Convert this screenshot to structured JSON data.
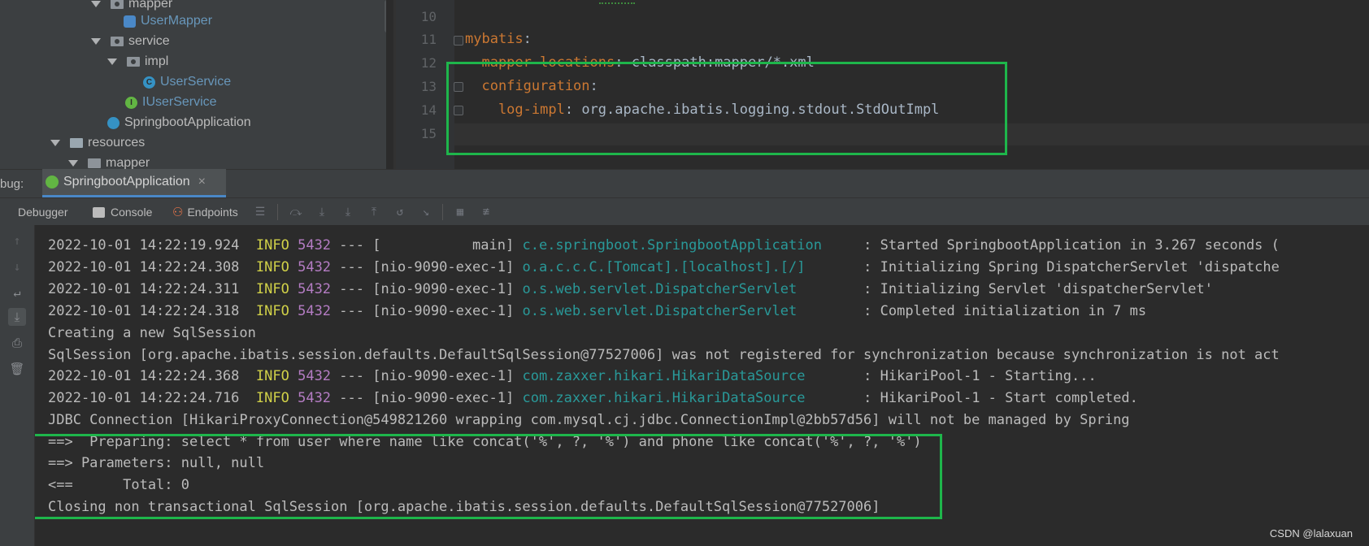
{
  "tree": {
    "items": [
      {
        "label": "mapper",
        "kind": "package"
      },
      {
        "label": "UserMapper",
        "kind": "mapper-interface"
      },
      {
        "label": "service",
        "kind": "package"
      },
      {
        "label": "impl",
        "kind": "package"
      },
      {
        "label": "UserService",
        "kind": "class"
      },
      {
        "label": "IUserService",
        "kind": "interface"
      },
      {
        "label": "SpringbootApplication",
        "kind": "spring-boot-class"
      },
      {
        "label": "resources",
        "kind": "folder"
      },
      {
        "label": "mapper",
        "kind": "folder"
      }
    ],
    "icons": {
      "class": "C",
      "interface": "I"
    }
  },
  "editor": {
    "lines": [
      {
        "num": "10",
        "key": "",
        "sep": "",
        "val": ""
      },
      {
        "num": "11",
        "key": "mybatis",
        "sep": ":",
        "val": ""
      },
      {
        "num": "12",
        "key": "  mapper-locations",
        "sep": ":",
        "val": " classpath:mapper/*.xml"
      },
      {
        "num": "13",
        "key": "  configuration",
        "sep": ":",
        "val": ""
      },
      {
        "num": "14",
        "key": "    log-impl",
        "sep": ":",
        "val": " org.apache.ibatis.logging.stdout.StdOutImpl"
      },
      {
        "num": "15",
        "key": "",
        "sep": "",
        "val": ""
      }
    ]
  },
  "debug": {
    "label": "bug:",
    "tab_label": "SpringbootApplication",
    "tab_close": "×",
    "toolbar": {
      "debugger": "Debugger",
      "console": "Console",
      "endpoints": "Endpoints"
    }
  },
  "console": {
    "lines": [
      {
        "ts": "2022-10-01 14:22:19.924",
        "level": "INFO",
        "pid": "5432",
        "sep": " --- ",
        "thread": "[           main]",
        "logger": "c.e.springboot.SpringbootApplication    ",
        "msg": ": Started SpringbootApplication in 3.267 seconds ("
      },
      {
        "ts": "2022-10-01 14:22:24.308",
        "level": "INFO",
        "pid": "5432",
        "sep": " --- ",
        "thread": "[nio-9090-exec-1]",
        "logger": "o.a.c.c.C.[Tomcat].[localhost].[/]      ",
        "msg": ": Initializing Spring DispatcherServlet 'dispatche"
      },
      {
        "ts": "2022-10-01 14:22:24.311",
        "level": "INFO",
        "pid": "5432",
        "sep": " --- ",
        "thread": "[nio-9090-exec-1]",
        "logger": "o.s.web.servlet.DispatcherServlet       ",
        "msg": ": Initializing Servlet 'dispatcherServlet'"
      },
      {
        "ts": "2022-10-01 14:22:24.318",
        "level": "INFO",
        "pid": "5432",
        "sep": " --- ",
        "thread": "[nio-9090-exec-1]",
        "logger": "o.s.web.servlet.DispatcherServlet       ",
        "msg": ": Completed initialization in 7 ms"
      },
      {
        "plain": "Creating a new SqlSession"
      },
      {
        "plain": "SqlSession [org.apache.ibatis.session.defaults.DefaultSqlSession@77527006] was not registered for synchronization because synchronization is not act"
      },
      {
        "ts": "2022-10-01 14:22:24.368",
        "level": "INFO",
        "pid": "5432",
        "sep": " --- ",
        "thread": "[nio-9090-exec-1]",
        "logger": "com.zaxxer.hikari.HikariDataSource      ",
        "msg": ": HikariPool-1 - Starting..."
      },
      {
        "ts": "2022-10-01 14:22:24.716",
        "level": "INFO",
        "pid": "5432",
        "sep": " --- ",
        "thread": "[nio-9090-exec-1]",
        "logger": "com.zaxxer.hikari.HikariDataSource      ",
        "msg": ": HikariPool-1 - Start completed."
      },
      {
        "plain": "JDBC Connection [HikariProxyConnection@549821260 wrapping com.mysql.cj.jdbc.ConnectionImpl@2bb57d56] will not be managed by Spring"
      },
      {
        "plain": "==>  Preparing: select * from user where name like concat('%', ?, '%') and phone like concat('%', ?, '%')"
      },
      {
        "plain": "==> Parameters: null, null"
      },
      {
        "plain": "<==      Total: 0"
      },
      {
        "plain": "Closing non transactional SqlSession [org.apache.ibatis.session.defaults.DefaultSqlSession@77527006]"
      }
    ]
  },
  "watermark": "CSDN @lalaxuan",
  "colors": {
    "highlight_box": "#1eb64b",
    "yaml_key": "#cc7832",
    "log_info": "#d0d048",
    "log_pid": "#b47cc3",
    "log_logger": "#299999"
  }
}
